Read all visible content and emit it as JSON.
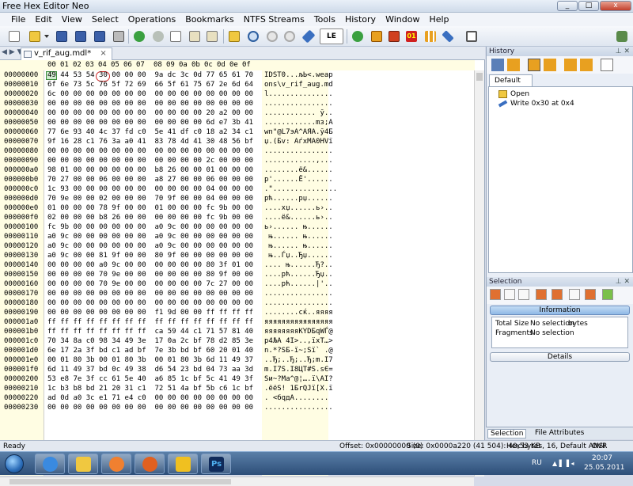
{
  "window": {
    "title": "Free Hex Editor Neo",
    "buttons": [
      "_",
      "□",
      "x"
    ]
  },
  "menu": [
    "File",
    "Edit",
    "View",
    "Select",
    "Operations",
    "Bookmarks",
    "NTFS Streams",
    "Tools",
    "History",
    "Window",
    "Help"
  ],
  "toolbar": {
    "icons": [
      "new-file-icon",
      "open-folder-icon",
      "dropdown-arrow-icon",
      "save-icon",
      "save-all-icon",
      "save-as-icon",
      "print-icon",
      "undo-icon",
      "redo-icon",
      "copy-icon",
      "edit-icon",
      "paste-icon",
      "import-icon",
      "find-icon",
      "find-next-icon",
      "find-prev-icon",
      "replace-icon",
      "encoding-icon",
      "jump-icon",
      "select-block-icon",
      "fill-icon",
      "bits-icon",
      "pattern-icon",
      "tools-icon",
      "layout-icon",
      "settings-icon"
    ],
    "encoding_label": "LE"
  },
  "editor": {
    "tab_nav": "◀ ▶ ▼",
    "tab": {
      "label": "v_rif_aug.mdl*",
      "close": "×"
    },
    "header_offsets": [
      "00",
      "01",
      "02",
      "03",
      "04",
      "05",
      "06",
      "07",
      "08",
      "09",
      "0a",
      "0b",
      "0c",
      "0d",
      "0e",
      "0f"
    ],
    "rows": [
      {
        "addr": "00000000",
        "hex": "49 44 53 54 30 00 00 00  9a dc 3c 0d 77 65 61 70",
        "ascii": "IDST0...љЬ<.weap"
      },
      {
        "addr": "00000010",
        "hex": "6f 6e 73 5c 76 5f 72 69  66 5f 61 75 67 2e 6d 64",
        "ascii": "ons\\v_rif_aug.md"
      },
      {
        "addr": "00000020",
        "hex": "6c 00 00 00 00 00 00 00  00 00 00 00 00 00 00 00",
        "ascii": "l..............."
      },
      {
        "addr": "00000030",
        "hex": "00 00 00 00 00 00 00 00  00 00 00 00 00 00 00 00",
        "ascii": "................"
      },
      {
        "addr": "00000040",
        "hex": "00 00 00 00 00 00 00 00  00 00 00 00 20 a2 00 00",
        "ascii": "............ ў.."
      },
      {
        "addr": "00000050",
        "hex": "00 00 00 00 00 00 00 00  00 00 00 00 6d e7 3b 41",
        "ascii": "............mз;A"
      },
      {
        "addr": "00000060",
        "hex": "77 6e 93 40 4c 37 fd c0  5e 41 df c0 18 a2 34 c1",
        "ascii": "wn\"@L7эА^AЯА.ў4Б"
      },
      {
        "addr": "00000070",
        "hex": "9f 16 28 c1 76 3a a0 41  83 78 4d 41 30 48 56 bf",
        "ascii": "џ.(Бv: AѓxMA0HVї"
      },
      {
        "addr": "00000080",
        "hex": "00 00 00 00 00 00 00 00  00 00 00 00 00 00 00 00",
        "ascii": "................"
      },
      {
        "addr": "00000090",
        "hex": "00 00 00 00 00 00 00 00  00 00 00 00 2c 00 00 00",
        "ascii": "............,..."
      },
      {
        "addr": "000000a0",
        "hex": "98 01 00 00 00 00 00 00  b8 26 00 00 01 00 00 00",
        "ascii": "........ё&......"
      },
      {
        "addr": "000000b0",
        "hex": "70 27 00 00 06 00 00 00  a8 27 00 00 06 00 00 00",
        "ascii": "p'......Ё'......"
      },
      {
        "addr": "000000c0",
        "hex": "1c 93 00 00 00 00 00 00  00 00 00 00 04 00 00 00",
        "ascii": ".\"..............."
      },
      {
        "addr": "000000d0",
        "hex": "70 9e 00 00 02 00 00 00  70 9f 00 00 04 00 00 00",
        "ascii": "pћ......pџ......"
      },
      {
        "addr": "000000e0",
        "hex": "01 00 00 00 78 9f 00 00  01 00 00 00 fc 9b 00 00",
        "ascii": "....xџ......ь›.."
      },
      {
        "addr": "000000f0",
        "hex": "02 00 00 00 b8 26 00 00  00 00 00 00 fc 9b 00 00",
        "ascii": "....ё&......ь›.."
      },
      {
        "addr": "00000100",
        "hex": "fc 9b 00 00 00 00 00 00  a0 9c 00 00 00 00 00 00",
        "ascii": "ь›...... њ......"
      },
      {
        "addr": "00000110",
        "hex": "a0 9c 00 00 00 00 00 00  a0 9c 00 00 00 00 00 00",
        "ascii": " њ...... њ......"
      },
      {
        "addr": "00000120",
        "hex": "a0 9c 00 00 00 00 00 00  a0 9c 00 00 00 00 00 00",
        "ascii": " њ...... њ......"
      },
      {
        "addr": "00000130",
        "hex": "a0 9c 00 00 81 9f 00 00  80 9f 00 00 00 00 00 00",
        "ascii": " њ..Ѓџ..Ђџ......"
      },
      {
        "addr": "00000140",
        "hex": "00 00 00 00 a0 9c 00 00  00 00 00 00 80 3f 01 00",
        "ascii": ".... њ......Ђ?.."
      },
      {
        "addr": "00000150",
        "hex": "00 00 00 00 70 9e 00 00  00 00 00 00 80 9f 00 00",
        "ascii": "....pћ......Ђџ.."
      },
      {
        "addr": "00000160",
        "hex": "00 00 00 00 70 9e 00 00  00 00 00 00 7c 27 00 00",
        "ascii": "....pћ......|'.."
      },
      {
        "addr": "00000170",
        "hex": "00 00 00 00 00 00 00 00  00 00 00 00 00 00 00 00",
        "ascii": "................"
      },
      {
        "addr": "00000180",
        "hex": "00 00 00 00 00 00 00 00  00 00 00 00 00 00 00 00",
        "ascii": "................"
      },
      {
        "addr": "00000190",
        "hex": "00 00 00 00 00 00 00 00  f1 9d 00 00 ff ff ff ff",
        "ascii": "........сќ..яяяя"
      },
      {
        "addr": "000001a0",
        "hex": "ff ff ff ff ff ff ff ff  ff ff ff ff ff ff ff ff",
        "ascii": "яяяяяяяяяяяяяяяя"
      },
      {
        "addr": "000001b0",
        "hex": "ff ff ff ff ff ff ff ff  ca 59 44 c1 71 57 81 40",
        "ascii": "яяяяяяяяКYDБqWЃ@"
      },
      {
        "addr": "000001c0",
        "hex": "70 34 8a c0 98 34 49 3e  17 0a 2c bf 78 d2 85 3e",
        "ascii": "p4ЉА 4I>..,їxТ…>"
      },
      {
        "addr": "000001d0",
        "hex": "6e 17 2a 3f bd c1 ad bf  7e 3b bd bf 60 20 01 40",
        "ascii": "n.*?SБ-ї~;Sї` .@"
      },
      {
        "addr": "000001e0",
        "hex": "00 01 80 3b 00 01 80 3b  00 01 80 3b 6d 11 49 37",
        "ascii": "..Ђ;..Ђ;..Ђ;m.I7"
      },
      {
        "addr": "000001f0",
        "hex": "6d 11 49 37 bd 0c 49 38  d6 54 23 bd 04 73 aa 3d",
        "ascii": "m.I7S.I8ЦT#S.sЄ="
      },
      {
        "addr": "00000200",
        "hex": "53 e8 7e 3f cc 61 5e 40  a6 85 1c bf 5c 41 49 3f",
        "ascii": "Sи~?Ma^@¦….ї\\AI?"
      },
      {
        "addr": "00000210",
        "hex": "1c b3 b8 bd 21 20 31 c1  72 51 4a bf 5b c6 1c bf",
        "ascii": ".ёёS! 1БrQJї[Х.ї"
      },
      {
        "addr": "00000220",
        "hex": "ad 0d a0 3c e1 71 e4 c0  00 00 00 00 00 00 00 00",
        "ascii": "­. <бqдА........"
      },
      {
        "addr": "00000230",
        "hex": "00 00 00 00 00 00 00 00  00 00 00 00 00 00 00 00",
        "ascii": "................"
      }
    ]
  },
  "history": {
    "title": "History",
    "tab": "Default",
    "items": [
      {
        "label": "Open",
        "icon": "folder-icon"
      },
      {
        "label": "Write 0x30 at 0x4",
        "icon": "pencil-icon"
      }
    ]
  },
  "selection": {
    "title": "Selection",
    "info_header": "Information",
    "fields": [
      {
        "name": "Total Size",
        "value": "No selection",
        "unit": "bytes"
      },
      {
        "name": "Fragments",
        "value": "No selection",
        "unit": ""
      }
    ],
    "details_label": "Details"
  },
  "bottom_tabs": [
    "Selection",
    "File Attributes"
  ],
  "status": {
    "left": "Ready",
    "offset": "Offset: 0x00000000 (0)",
    "size": "Size: 0x0000a220 (41 504): 40,53 KB",
    "mode": "Hex bytes, 16, Default ANSI",
    "ovr": "OVR"
  },
  "taskbar": {
    "apps": [
      "ie-icon",
      "explorer-icon",
      "media-player-icon",
      "firefox-icon",
      "hex-editor-icon",
      "photoshop-icon"
    ],
    "lang": "RU",
    "time": "20:07",
    "date": "25.05.2011"
  }
}
